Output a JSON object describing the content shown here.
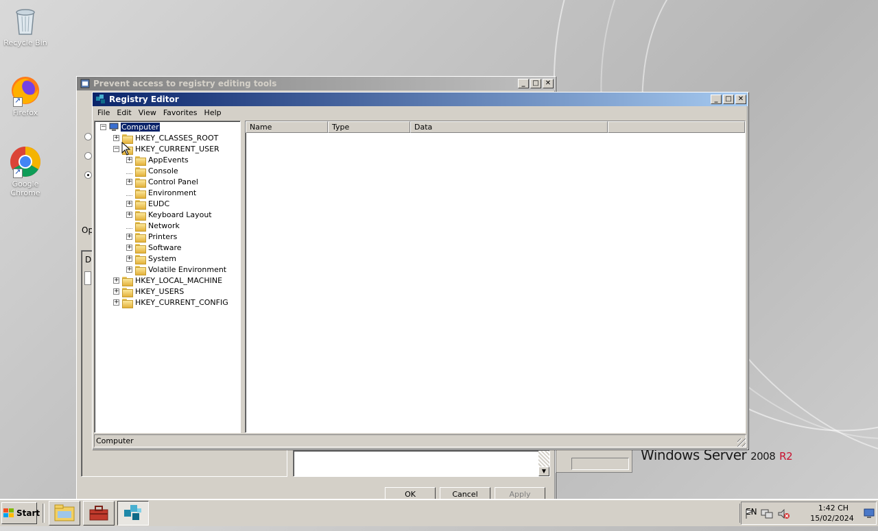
{
  "desktop": {
    "icons": [
      {
        "label": "Recycle Bin"
      },
      {
        "label": "Firefox"
      },
      {
        "label": "Google Chrome"
      }
    ],
    "brand": {
      "name": "Windows Server",
      "version": "2008",
      "edition": "R2"
    }
  },
  "gp_dialog": {
    "title": "Prevent access to registry editing tools",
    "partial_label_op": "Op",
    "partial_label_d": "D",
    "buttons": {
      "ok": "OK",
      "cancel": "Cancel",
      "apply": "Apply"
    }
  },
  "regedit": {
    "title": "Registry Editor",
    "menu": [
      "File",
      "Edit",
      "View",
      "Favorites",
      "Help"
    ],
    "tree": {
      "root": "Computer",
      "hives": [
        {
          "label": "HKEY_CLASSES_ROOT",
          "expanded": false
        },
        {
          "label": "HKEY_CURRENT_USER",
          "expanded": true,
          "children": [
            {
              "label": "AppEvents",
              "expandable": true
            },
            {
              "label": "Console",
              "expandable": false
            },
            {
              "label": "Control Panel",
              "expandable": true
            },
            {
              "label": "Environment",
              "expandable": false
            },
            {
              "label": "EUDC",
              "expandable": true
            },
            {
              "label": "Keyboard Layout",
              "expandable": true
            },
            {
              "label": "Network",
              "expandable": false
            },
            {
              "label": "Printers",
              "expandable": true
            },
            {
              "label": "Software",
              "expandable": true
            },
            {
              "label": "System",
              "expandable": true
            },
            {
              "label": "Volatile Environment",
              "expandable": true
            }
          ]
        },
        {
          "label": "HKEY_LOCAL_MACHINE",
          "expanded": false
        },
        {
          "label": "HKEY_USERS",
          "expanded": false
        },
        {
          "label": "HKEY_CURRENT_CONFIG",
          "expanded": false
        }
      ]
    },
    "columns": {
      "name": "Name",
      "type": "Type",
      "data": "Data"
    },
    "status": "Computer"
  },
  "taskbar": {
    "start_label": "Start",
    "language": "EN",
    "time": "1:42 CH",
    "date": "15/02/2024"
  }
}
